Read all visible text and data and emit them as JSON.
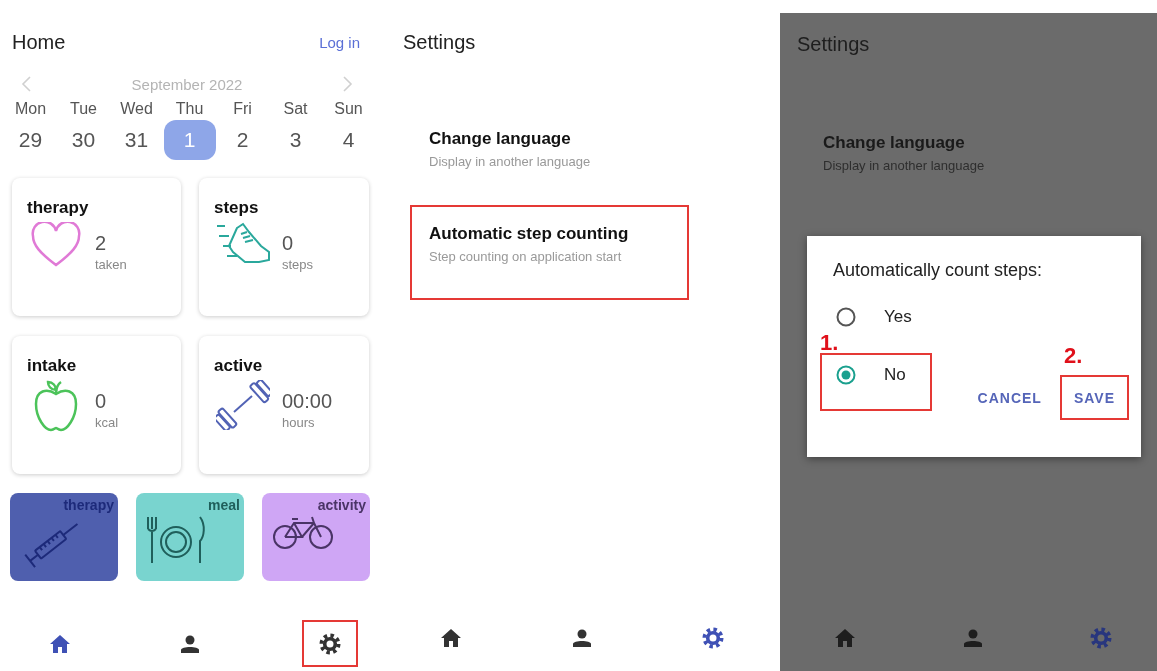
{
  "home_screen": {
    "title": "Home",
    "login": "Log in",
    "calendar": {
      "month": "September 2022",
      "days": [
        {
          "weekday": "Mon",
          "date": "29",
          "selected": false
        },
        {
          "weekday": "Tue",
          "date": "30",
          "selected": false
        },
        {
          "weekday": "Wed",
          "date": "31",
          "selected": false
        },
        {
          "weekday": "Thu",
          "date": "1",
          "selected": true
        },
        {
          "weekday": "Fri",
          "date": "2",
          "selected": false
        },
        {
          "weekday": "Sat",
          "date": "3",
          "selected": false
        },
        {
          "weekday": "Sun",
          "date": "4",
          "selected": false
        }
      ]
    },
    "cards": [
      {
        "kind": "therapy",
        "title": "therapy",
        "value": "2",
        "unit": "taken"
      },
      {
        "kind": "steps",
        "title": "steps",
        "value": "0",
        "unit": "steps"
      },
      {
        "kind": "intake",
        "title": "intake",
        "value": "0",
        "unit": "kcal"
      },
      {
        "kind": "active",
        "title": "active",
        "value": "00:00",
        "unit": "hours"
      }
    ],
    "tiles": [
      {
        "kind": "therapy",
        "label": "therapy",
        "color": "#4f5fae"
      },
      {
        "kind": "meal",
        "label": "meal",
        "color": "#79d4cf"
      },
      {
        "kind": "activity",
        "label": "activity",
        "color": "#cfa6f5"
      }
    ],
    "nav": [
      {
        "kind": "home",
        "selected": true,
        "highlighted": false
      },
      {
        "kind": "profile",
        "selected": false,
        "highlighted": false
      },
      {
        "kind": "settings",
        "selected": false,
        "highlighted": true
      }
    ]
  },
  "settings_screen": {
    "title": "Settings",
    "items": [
      {
        "title": "Change language",
        "subtitle": "Display in another language",
        "highlighted": false
      },
      {
        "title": "Automatic step counting",
        "subtitle": "Step counting on application start",
        "highlighted": true
      }
    ],
    "nav": [
      {
        "kind": "home",
        "selected": false,
        "highlighted": false
      },
      {
        "kind": "profile",
        "selected": false,
        "highlighted": false
      },
      {
        "kind": "settings",
        "selected": true,
        "highlighted": false
      }
    ]
  },
  "dialog_screen": {
    "title": "Settings",
    "items": [
      {
        "title": "Change language",
        "subtitle": "Display in another language"
      }
    ],
    "dialog": {
      "title": "Automatically count steps:",
      "options": [
        {
          "label": "Yes",
          "selected": false,
          "highlighted": false
        },
        {
          "label": "No",
          "selected": true,
          "highlighted": true,
          "annotation": "1."
        }
      ],
      "buttons": [
        {
          "label": "CANCEL",
          "highlighted": false
        },
        {
          "label": "SAVE",
          "highlighted": true,
          "annotation": "2."
        }
      ]
    },
    "nav": [
      {
        "kind": "home",
        "selected": false,
        "highlighted": false
      },
      {
        "kind": "profile",
        "selected": false,
        "highlighted": false
      },
      {
        "kind": "settings",
        "selected": true,
        "highlighted": false
      }
    ]
  }
}
